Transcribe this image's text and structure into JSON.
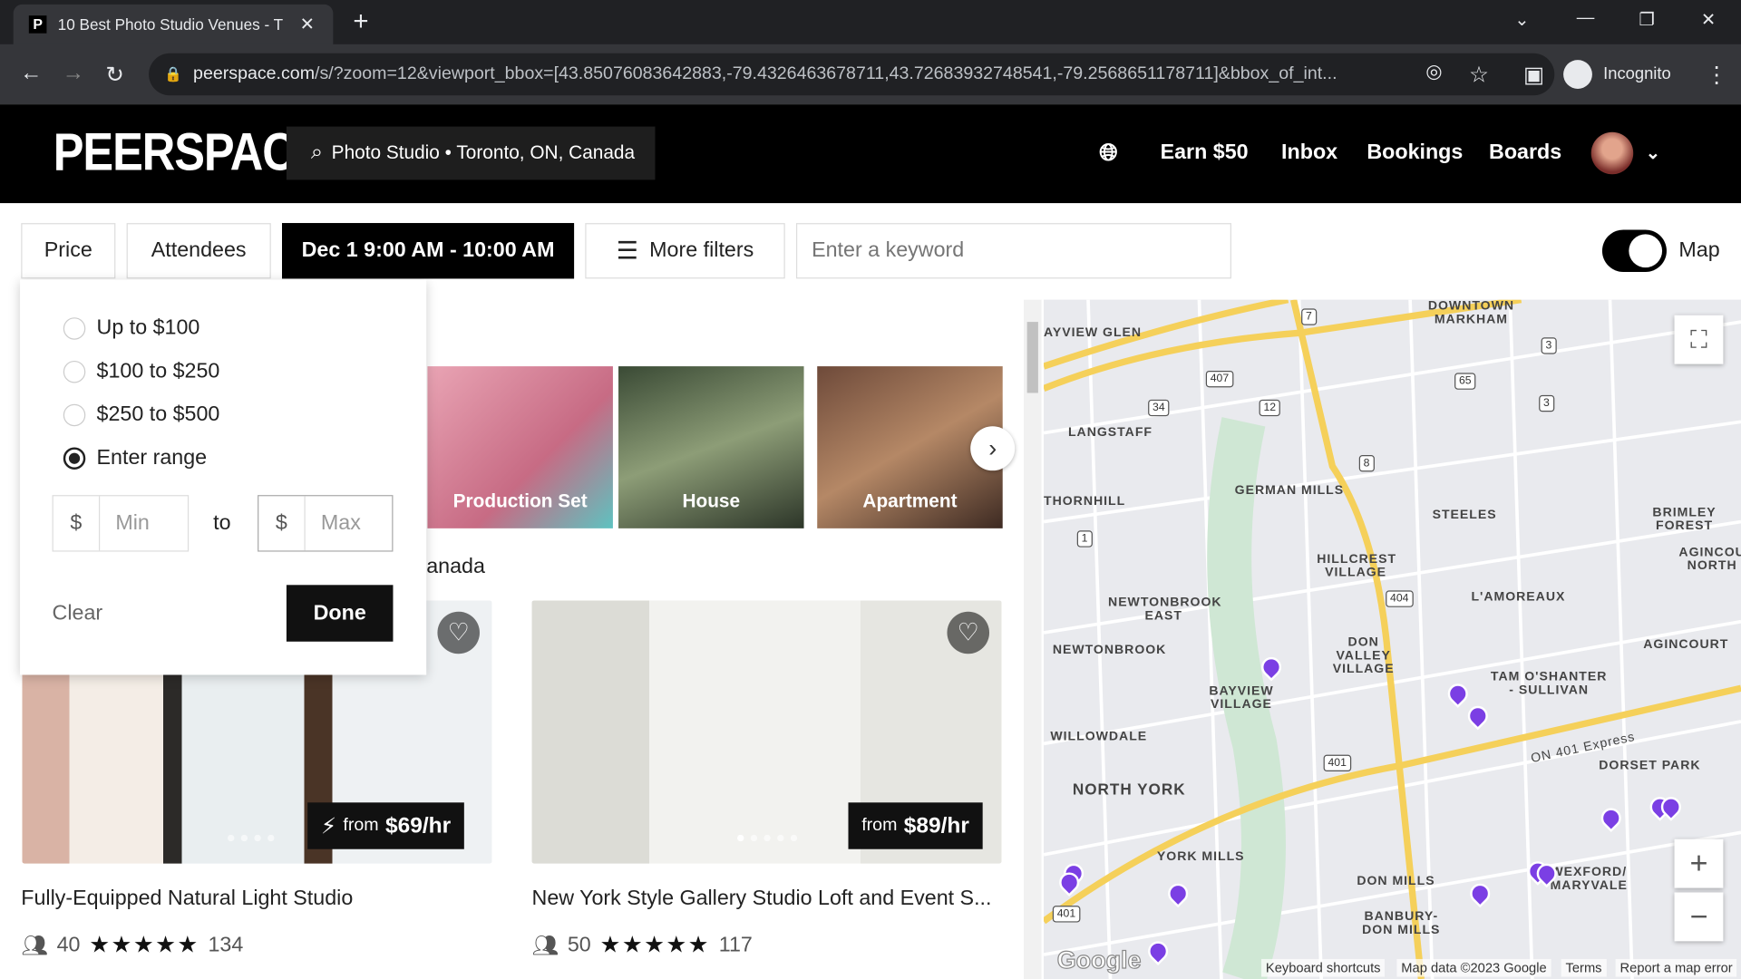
{
  "browser": {
    "tab_title": "10 Best Photo Studio Venues - T",
    "favicon": "P",
    "url_host": "peerspace.com",
    "url_path": "/s/?zoom=12&viewport_bbox=[43.85076083642883,-79.4326463678711,43.72683932748541,-79.2568651178711]&bbox_of_int...",
    "profile": "Incognito"
  },
  "header": {
    "logo": "PEERSPACE",
    "search": "Photo Studio • Toronto, ON, Canada",
    "nav": [
      "Earn $50",
      "Inbox",
      "Bookings",
      "Boards"
    ]
  },
  "filters": {
    "price": "Price",
    "attendees": "Attendees",
    "date": "Dec 1 9:00 AM - 10:00 AM",
    "more": "More filters",
    "keyword_placeholder": "Enter a keyword",
    "map_label": "Map",
    "map_toggle_on": true
  },
  "price_dropdown": {
    "options": [
      "Up to $100",
      "$100 to $250",
      "$250 to $500",
      "Enter range"
    ],
    "selected": 3,
    "currency": "$",
    "min_placeholder": "Min",
    "to": "to",
    "max_placeholder": "Max",
    "clear": "Clear",
    "done": "Done"
  },
  "categories": [
    "Production Set",
    "House",
    "Apartment"
  ],
  "results_heading_fragment": "anada",
  "listings": [
    {
      "title": "Fully-Equipped Natural Light Studio",
      "price_prefix": "from",
      "price": "$69/hr",
      "instant": true,
      "capacity": "40",
      "rating": 5,
      "reviews": "134"
    },
    {
      "title": "New York Style Gallery Studio Loft and Event S...",
      "price_prefix": "from",
      "price": "$89/hr",
      "instant": false,
      "capacity": "50",
      "rating": 5,
      "reviews": "117"
    }
  ],
  "map": {
    "labels": [
      "AYVIEW GLEN",
      "DOWNTOWN MARKHAM",
      "LANGSTAFF",
      "GERMAN MILLS",
      "THORNHILL",
      "STEELES",
      "BRIMLEY FOREST",
      "HILLCREST VILLAGE",
      "AGINCOURT NORTH",
      "NEWTONBROOK EAST",
      "L'AMOREAUX",
      "NEWTONBROOK",
      "DON VALLEY VILLAGE",
      "AGINCOURT",
      "BAYVIEW VILLAGE",
      "TAM O'SHANTER - SULLIVAN",
      "WILLOWDALE",
      "NORTH YORK",
      "DORSET PARK",
      "YORK MILLS",
      "DON MILLS",
      "WEXFORD/ MARYVALE",
      "BANBURY-DON MILLS",
      "ON 401 Express"
    ],
    "shields": [
      "7",
      "407",
      "34",
      "12",
      "65",
      "3",
      "3",
      "8",
      "1",
      "404",
      "401",
      "401"
    ],
    "footer": [
      "Keyboard shortcuts",
      "Map data ©2023 Google",
      "Terms",
      "Report a map error"
    ],
    "logo": "Google",
    "pin_color": "#7b3fe4"
  }
}
